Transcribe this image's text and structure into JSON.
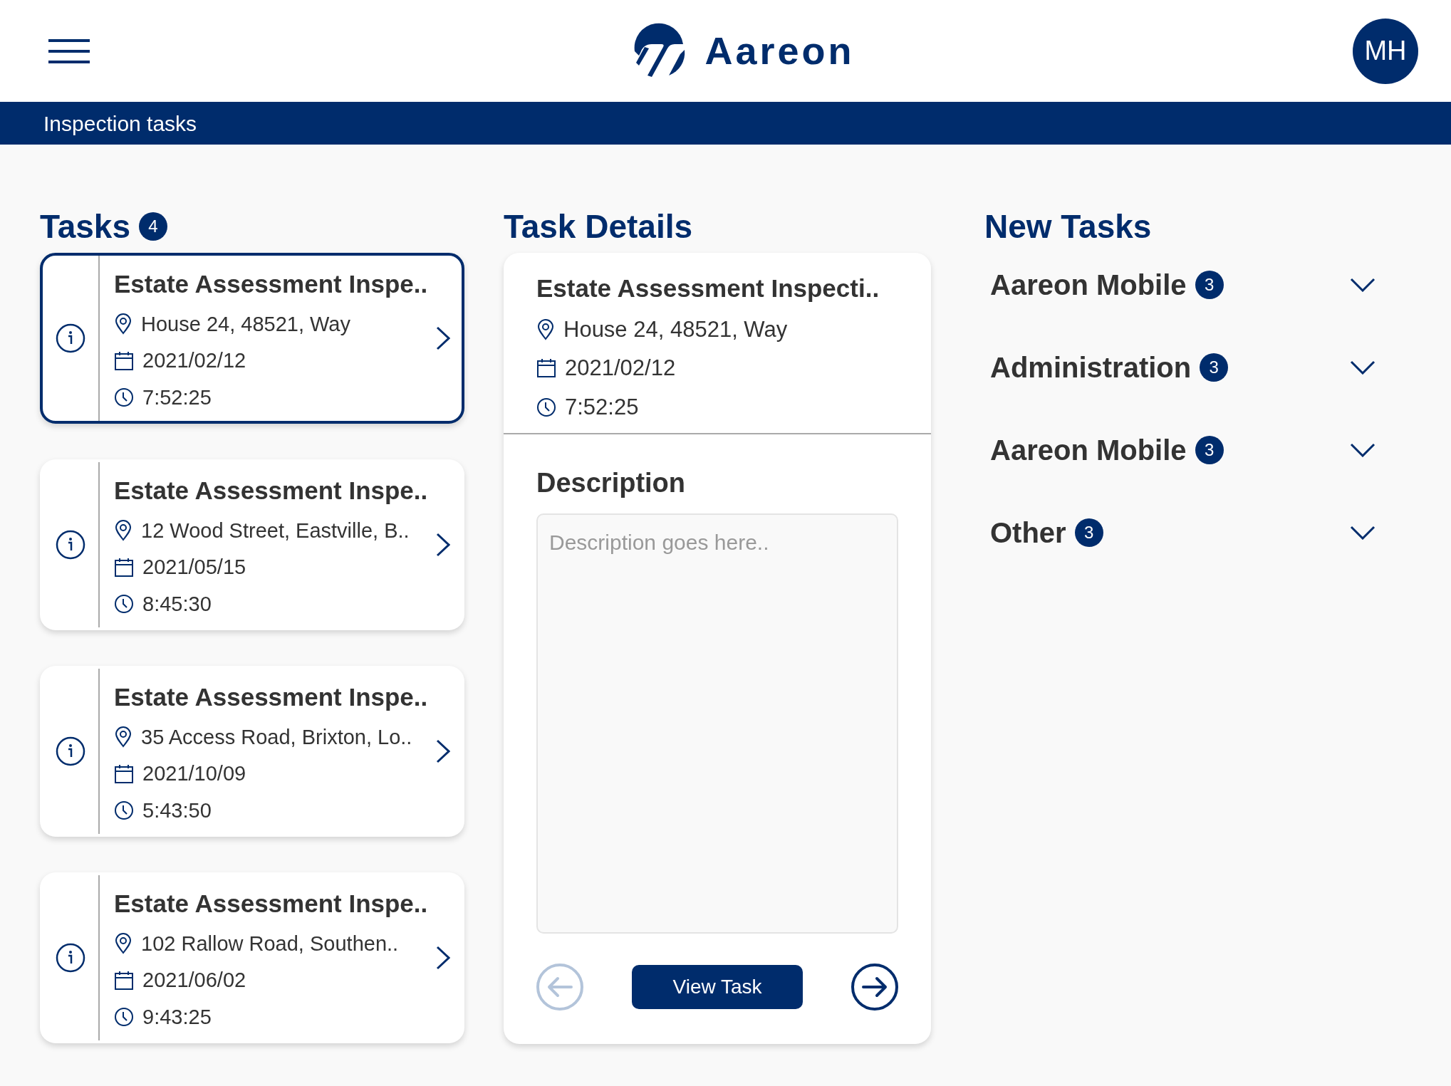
{
  "header": {
    "logo_text": "Aareon",
    "avatar_initials": "MH"
  },
  "title_bar": {
    "title": "Inspection tasks"
  },
  "tasks": {
    "heading": "Tasks",
    "count": "4",
    "items": [
      {
        "title": "Estate Assessment Inspe..",
        "address": "House 24, 48521, Way",
        "date": "2021/02/12",
        "time": "7:52:25",
        "selected": true
      },
      {
        "title": "Estate Assessment Inspe..",
        "address": "12 Wood Street, Eastville, B..",
        "date": "2021/05/15",
        "time": "8:45:30",
        "selected": false
      },
      {
        "title": "Estate Assessment Inspe..",
        "address": "35 Access Road, Brixton, Lo..",
        "date": "2021/10/09",
        "time": "5:43:50",
        "selected": false
      },
      {
        "title": "Estate Assessment Inspe..",
        "address": "102 Rallow Road, Southen..",
        "date": "2021/06/02",
        "time": "9:43:25",
        "selected": false
      }
    ]
  },
  "task_details": {
    "heading": "Task Details",
    "title": "Estate Assessment Inspecti..",
    "address": "House 24, 48521, Way",
    "date": "2021/02/12",
    "time": "7:52:25",
    "description_label": "Description",
    "description_placeholder": "Description goes here..",
    "previous_button": {
      "disabled": true
    },
    "view_button": "View Task",
    "next_button": {
      "disabled": false
    }
  },
  "new_tasks": {
    "heading": "New Tasks",
    "groups": [
      {
        "name": "Aareon Mobile",
        "count": "3",
        "expanded": false
      },
      {
        "name": "Administration",
        "count": "3",
        "expanded": false
      },
      {
        "name": "Aareon Mobile",
        "count": "3",
        "expanded": false
      },
      {
        "name": "Other",
        "count": "3",
        "expanded": false
      }
    ]
  }
}
